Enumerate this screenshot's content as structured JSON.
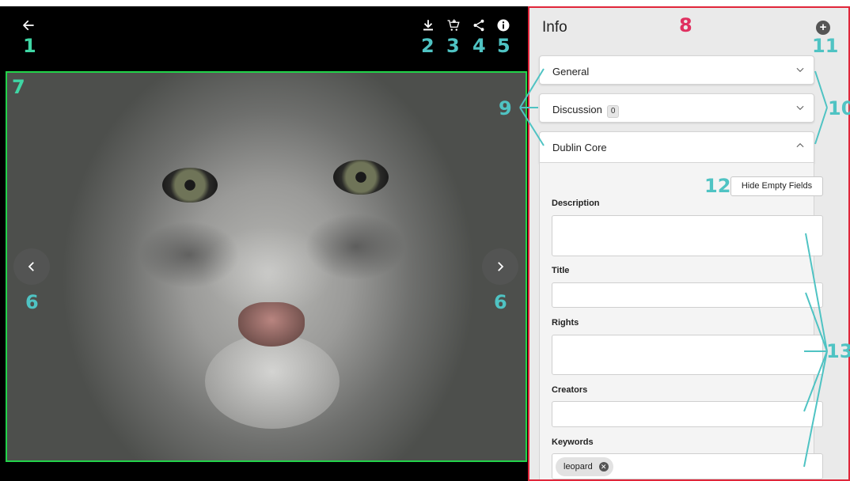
{
  "toolbar": {
    "back_icon": "arrow-left-icon",
    "download_icon": "download-icon",
    "cart_icon": "add-to-cart-icon",
    "share_icon": "share-icon",
    "info_icon": "info-icon"
  },
  "viewer": {
    "prev_icon": "chevron-left-icon",
    "next_icon": "chevron-right-icon"
  },
  "callouts": {
    "back": "1",
    "download": "2",
    "cart": "3",
    "share": "4",
    "info": "5",
    "nav_left": "6",
    "nav_right": "6",
    "image": "7",
    "panel": "8",
    "sections": "9",
    "chevrons": "10",
    "add": "11",
    "hide_empty": "12",
    "fields": "13"
  },
  "info_panel": {
    "title": "Info",
    "add_icon": "plus-circle-icon",
    "sections": [
      {
        "label": "General",
        "chevron": "chevron-down-icon"
      },
      {
        "label": "Discussion",
        "badge": "0",
        "chevron": "chevron-down-icon"
      },
      {
        "label": "Dublin Core",
        "chevron": "chevron-up-icon"
      }
    ],
    "hide_empty_label": "Hide Empty Fields",
    "fields": [
      {
        "label": "Description",
        "value": ""
      },
      {
        "label": "Title",
        "value": ""
      },
      {
        "label": "Rights",
        "value": ""
      },
      {
        "label": "Creators",
        "value": ""
      },
      {
        "label": "Keywords",
        "tags": [
          "leopard"
        ]
      }
    ]
  },
  "colors": {
    "image_frame": "#22d34a",
    "panel_border": "#e0263a",
    "callout_teal": "#4fc3c3",
    "callout_red": "#e03060"
  }
}
